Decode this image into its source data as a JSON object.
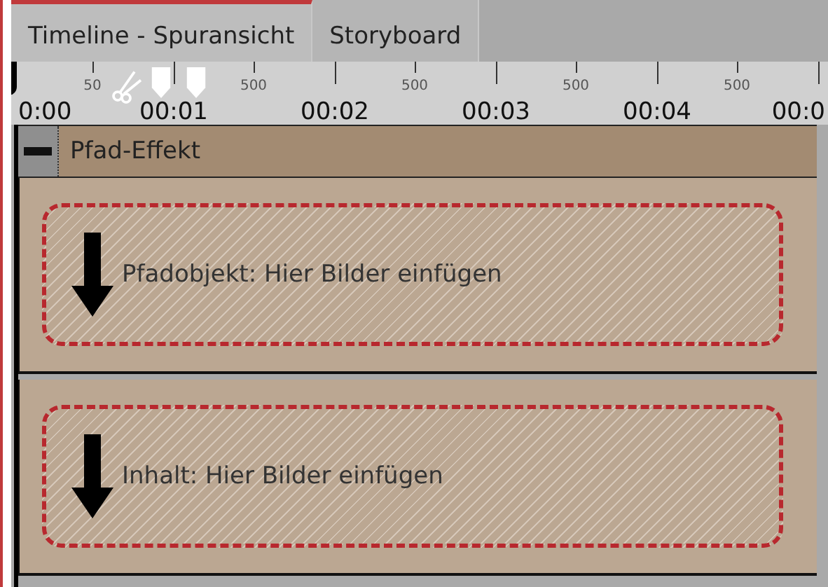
{
  "tabs": [
    {
      "label": "Timeline - Spuransicht",
      "selected": true
    },
    {
      "label": "Storyboard",
      "selected": false
    }
  ],
  "ruler": {
    "marks": [
      {
        "time": "0:00",
        "half": "50"
      },
      {
        "time": "00:01",
        "half": "500"
      },
      {
        "time": "00:02",
        "half": "500"
      },
      {
        "time": "00:03",
        "half": "500"
      },
      {
        "time": "00:04",
        "half": "500"
      },
      {
        "time": "00:0"
      }
    ]
  },
  "effect": {
    "title": "Pfad-Effekt",
    "expanded": true
  },
  "tracks": [
    {
      "label": "Pfadobjekt: Hier Bilder einfügen"
    },
    {
      "label": "Inhalt: Hier Bilder einfügen"
    }
  ]
}
